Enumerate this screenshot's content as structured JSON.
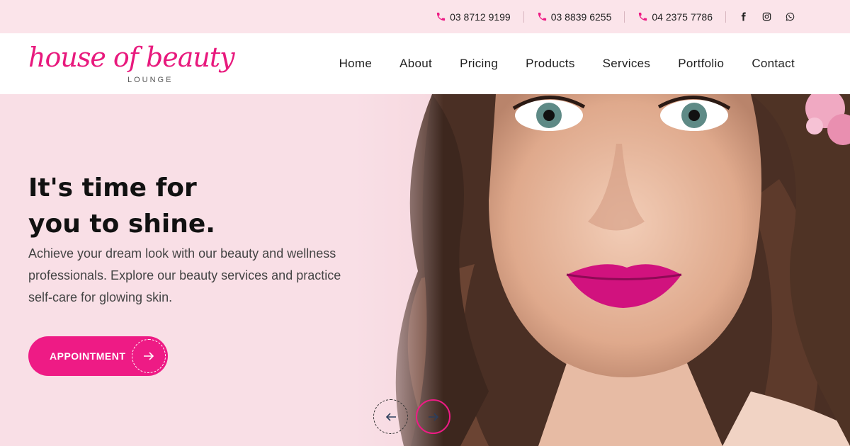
{
  "colors": {
    "accent": "#ee1b85",
    "background": "#fbe4ea",
    "nav_bg": "#ffffff"
  },
  "topbar": {
    "phones": [
      {
        "icon": "phone-icon",
        "number": "03 8712 9199"
      },
      {
        "icon": "phone-icon",
        "number": "03 8839 6255"
      },
      {
        "icon": "phone-icon",
        "number": "04 2375 7786"
      }
    ],
    "social": [
      "facebook-icon",
      "instagram-icon",
      "whatsapp-icon"
    ]
  },
  "logo": {
    "main": "house of beauty",
    "sub": "LOUNGE"
  },
  "nav": {
    "items": [
      "Home",
      "About",
      "Pricing",
      "Products",
      "Services",
      "Portfolio",
      "Contact"
    ]
  },
  "hero": {
    "headline_line1": "It's time for",
    "headline_line2": "you to shine.",
    "description": "Achieve your dream look with our beauty and wellness professionals. Explore our beauty services and practice self-care for glowing skin.",
    "button_label": "APPOINTMENT"
  }
}
